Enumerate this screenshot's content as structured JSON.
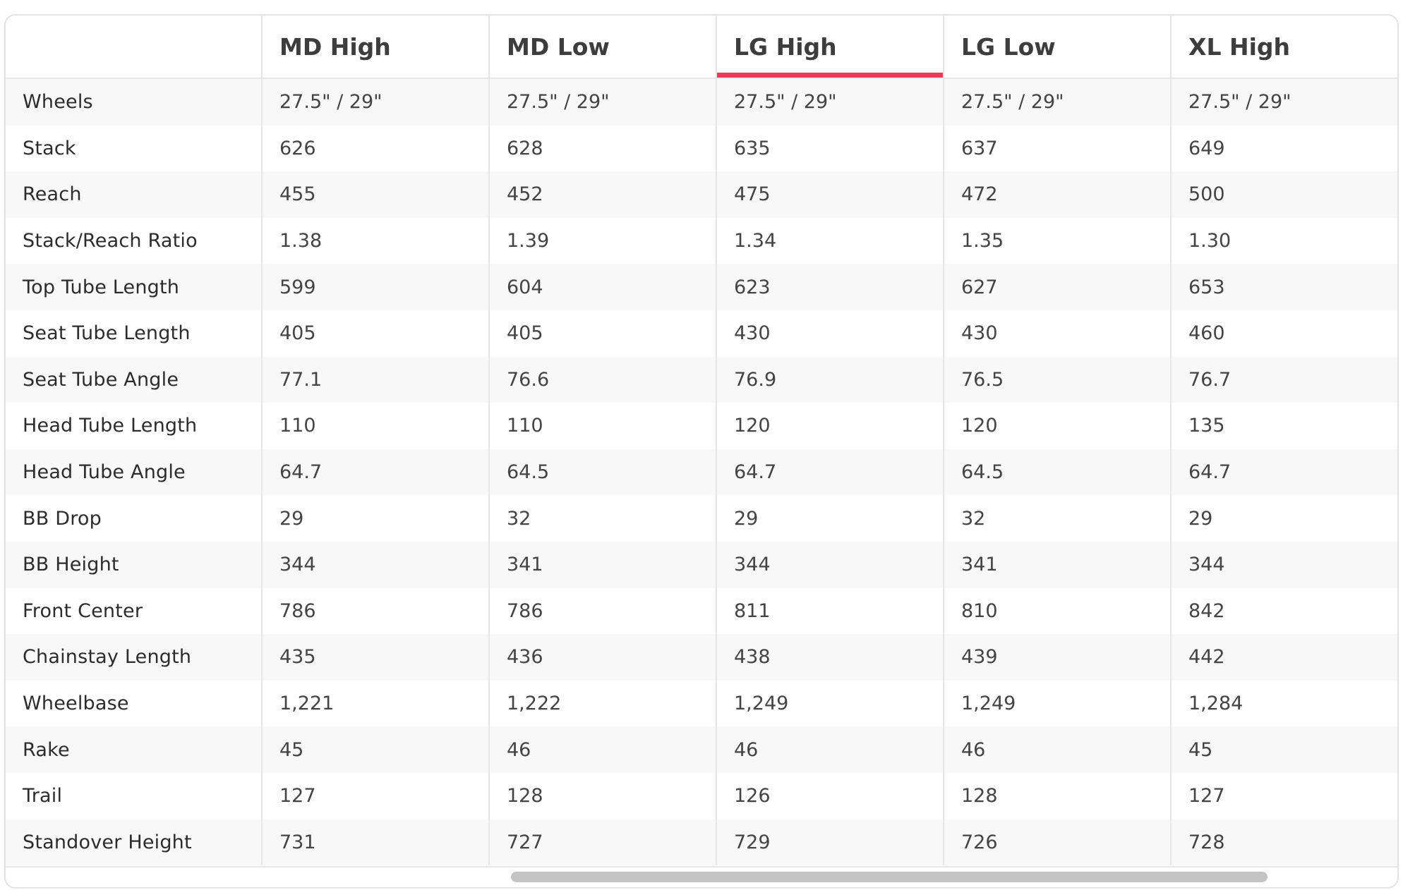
{
  "table": {
    "columns": [
      "",
      "MD High",
      "MD Low",
      "LG High",
      "LG Low",
      "XL High"
    ],
    "active_column": "LG High",
    "rows": [
      [
        "Wheels",
        "27.5\" / 29\"",
        "27.5\" / 29\"",
        "27.5\" / 29\"",
        "27.5\" / 29\"",
        "27.5\" / 29\""
      ],
      [
        "Stack",
        "626",
        "628",
        "635",
        "637",
        "649"
      ],
      [
        "Reach",
        "455",
        "452",
        "475",
        "472",
        "500"
      ],
      [
        "Stack/Reach Ratio",
        "1.38",
        "1.39",
        "1.34",
        "1.35",
        "1.30"
      ],
      [
        "Top Tube Length",
        "599",
        "604",
        "623",
        "627",
        "653"
      ],
      [
        "Seat Tube Length",
        "405",
        "405",
        "430",
        "430",
        "460"
      ],
      [
        "Seat Tube Angle",
        "77.1",
        "76.6",
        "76.9",
        "76.5",
        "76.7"
      ],
      [
        "Head Tube Length",
        "110",
        "110",
        "120",
        "120",
        "135"
      ],
      [
        "Head Tube Angle",
        "64.7",
        "64.5",
        "64.7",
        "64.5",
        "64.7"
      ],
      [
        "BB Drop",
        "29",
        "32",
        "29",
        "32",
        "29"
      ],
      [
        "BB Height",
        "344",
        "341",
        "344",
        "341",
        "344"
      ],
      [
        "Front Center",
        "786",
        "786",
        "811",
        "810",
        "842"
      ],
      [
        "Chainstay Length",
        "435",
        "436",
        "438",
        "439",
        "442"
      ],
      [
        "Wheelbase",
        "1,221",
        "1,222",
        "1,249",
        "1,249",
        "1,284"
      ],
      [
        "Rake",
        "45",
        "46",
        "46",
        "46",
        "45"
      ],
      [
        "Trail",
        "127",
        "128",
        "126",
        "128",
        "127"
      ],
      [
        "Standover Height",
        "731",
        "727",
        "729",
        "726",
        "728"
      ]
    ]
  },
  "colors": {
    "active_underline": "#e8385a",
    "stripe": "#f8f8f8",
    "border": "#e6e6e6"
  }
}
